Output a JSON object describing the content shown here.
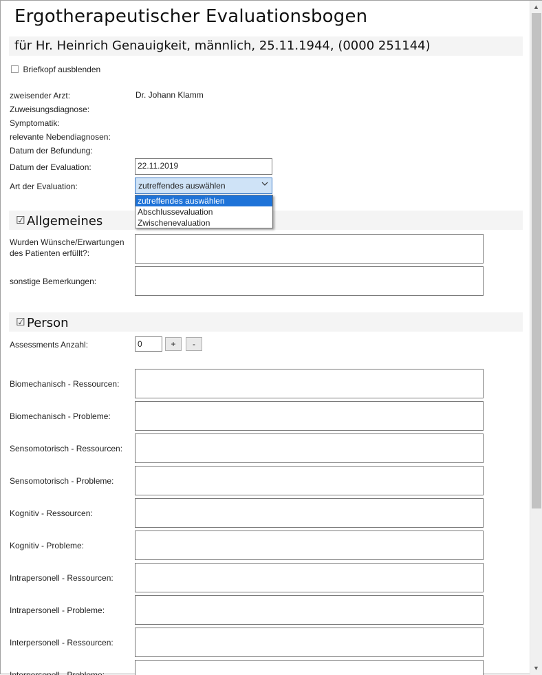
{
  "header": {
    "title": "Ergotherapeutischer Evaluationsbogen",
    "patient_line": "für Hr. Heinrich Genauigkeit, männlich, 25.11.1944, (0000 251144)",
    "hide_letterhead_label": "Briefkopf ausblenden",
    "hide_letterhead_checked": false
  },
  "info": {
    "referring_doctor_label": "zweisender Arzt:",
    "referring_doctor_value": "Dr. Johann Klamm",
    "referral_diagnosis_label": "Zuweisungsdiagnose:",
    "symptoms_label": "Symptomatik:",
    "secondary_diagnoses_label": "relevante Nebendiagnosen:",
    "finding_date_label": "Datum der Befundung:",
    "evaluation_date_label": "Datum der Evaluation:",
    "evaluation_date_value": "22.11.2019",
    "evaluation_type_label": "Art der Evaluation:",
    "evaluation_type_selected": "zutreffendes auswählen",
    "evaluation_type_options": [
      "zutreffendes auswählen",
      "Abschlussevaluation",
      "Zwischenevaluation"
    ]
  },
  "section_general": {
    "title": "Allgemeines",
    "checked": true,
    "wishes_label": "Wurden Wünsche/Erwartungen des Patienten erfüllt?:",
    "remarks_label": "sonstige Bemerkungen:"
  },
  "section_person": {
    "title": "Person",
    "checked": true,
    "assessments_label": "Assessments Anzahl:",
    "assessments_value": "0",
    "plus_label": "+",
    "minus_label": "-",
    "fields": [
      "Biomechanisch - Ressourcen:",
      "Biomechanisch - Probleme:",
      "Sensomotorisch - Ressourcen:",
      "Sensomotorisch - Probleme:",
      "Kognitiv - Ressourcen:",
      "Kognitiv - Probleme:",
      "Intrapersonell - Ressourcen:",
      "Intrapersonell - Probleme:",
      "Interpersonell - Ressourcen:",
      "Interpersonell - Probleme:"
    ]
  }
}
